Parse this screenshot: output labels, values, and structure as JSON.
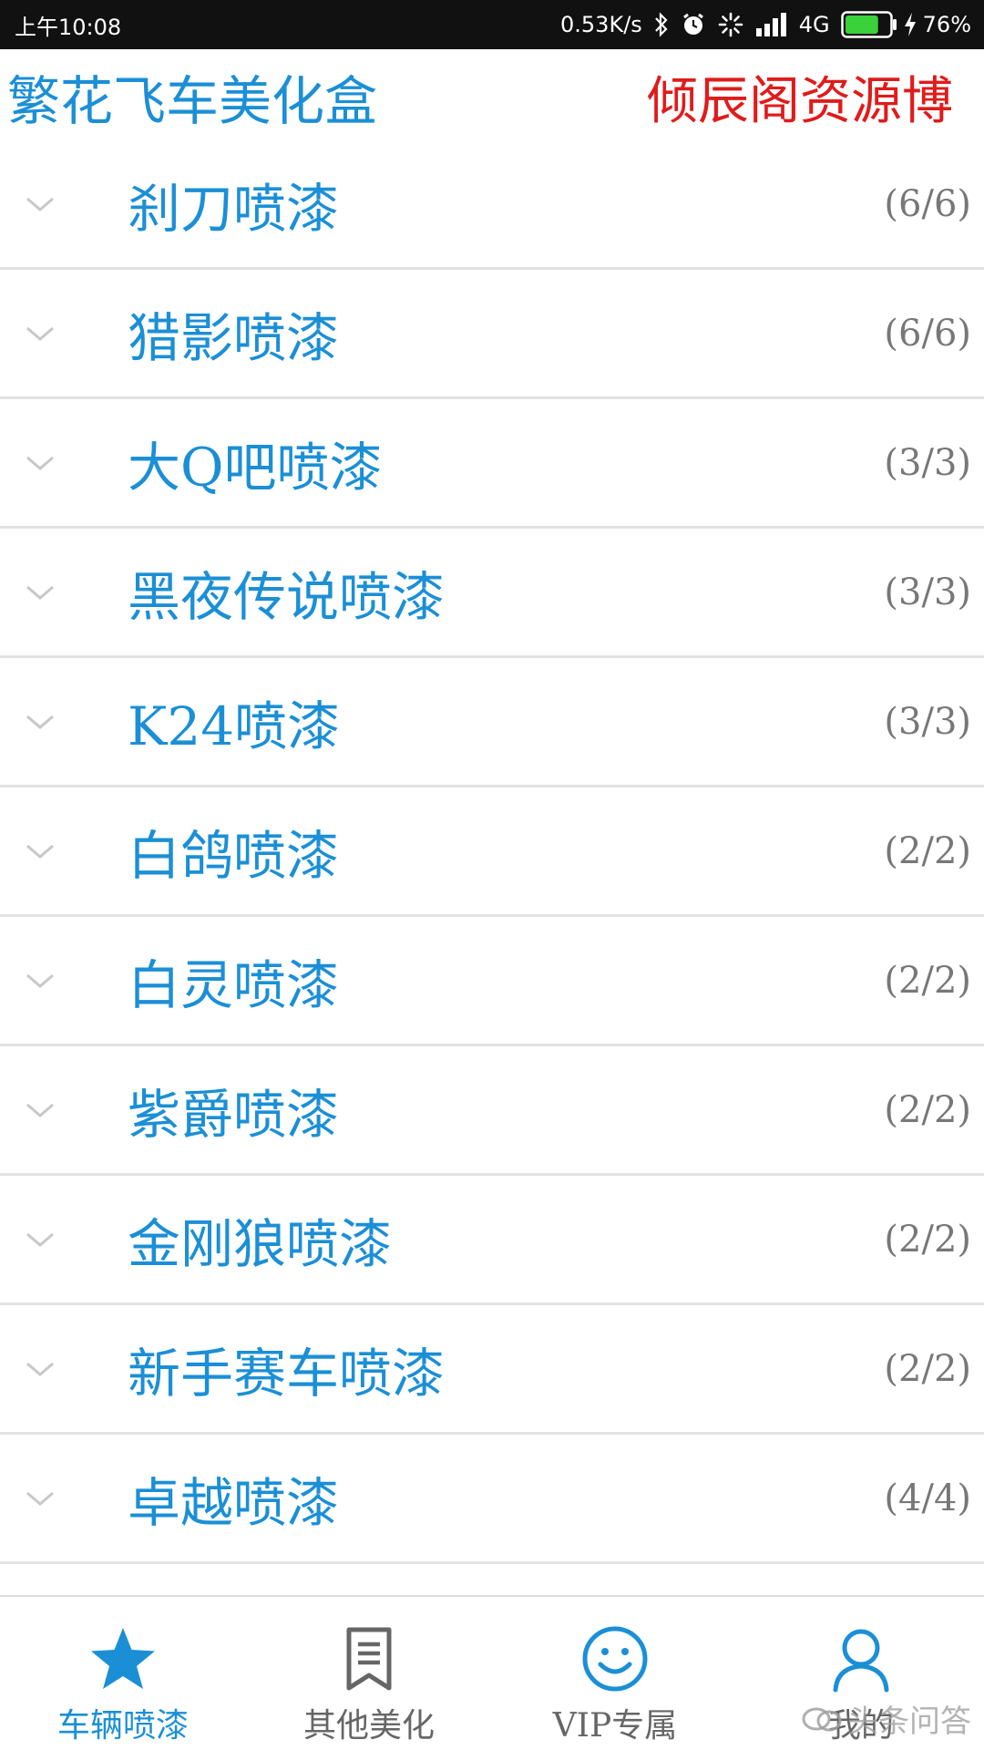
{
  "status_bar": {
    "time": "上午10:08",
    "net_speed": "0.53K/s",
    "network": "4G",
    "battery": "76%",
    "battery_level": 0.76
  },
  "header": {
    "title_left": "繁花飞车美化盒",
    "title_right": "倾辰阁资源博"
  },
  "list": {
    "items": [
      {
        "label": "刹刀喷漆",
        "count": "(6/6)"
      },
      {
        "label": "猎影喷漆",
        "count": "(6/6)"
      },
      {
        "label": "大Q吧喷漆",
        "count": "(3/3)"
      },
      {
        "label": "黑夜传说喷漆",
        "count": "(3/3)"
      },
      {
        "label": "K24喷漆",
        "count": "(3/3)"
      },
      {
        "label": "白鸽喷漆",
        "count": "(2/2)"
      },
      {
        "label": "白灵喷漆",
        "count": "(2/2)"
      },
      {
        "label": "紫爵喷漆",
        "count": "(2/2)"
      },
      {
        "label": "金刚狼喷漆",
        "count": "(2/2)"
      },
      {
        "label": "新手赛车喷漆",
        "count": "(2/2)"
      },
      {
        "label": "卓越喷漆",
        "count": "(4/4)"
      }
    ]
  },
  "bottom_nav": {
    "items": [
      {
        "label": "车辆喷漆",
        "icon": "star-icon",
        "active": true
      },
      {
        "label": "其他美化",
        "icon": "bookmark-icon",
        "active": false
      },
      {
        "label": "VIP专属",
        "icon": "smiley-icon",
        "active": false
      },
      {
        "label": "我的",
        "icon": "user-icon",
        "active": false
      }
    ]
  },
  "watermark": {
    "text": "头条问答"
  },
  "colors": {
    "accent": "#1b8fd6",
    "header_right": "#e01b1b",
    "divider": "#e2e2e2",
    "count_text": "#777777"
  }
}
